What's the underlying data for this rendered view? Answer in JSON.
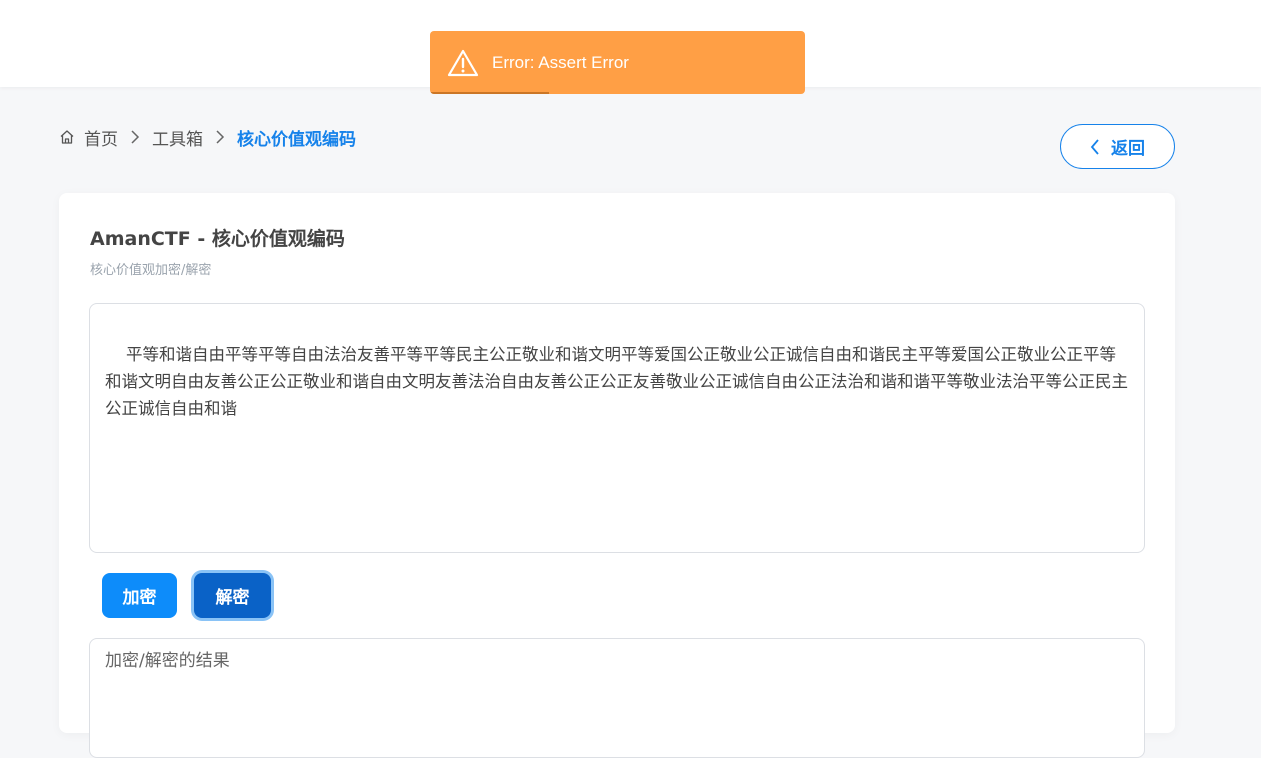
{
  "toast": {
    "message": "Error: Assert Error",
    "icon": "warning-icon",
    "color": "#ff9f45"
  },
  "breadcrumb": {
    "items": [
      "首页",
      "工具箱",
      "核心价值观编码"
    ]
  },
  "back_button": {
    "label": "返回"
  },
  "card": {
    "title": "AmanCTF - 核心价值观编码",
    "subtitle": "核心价值观加密/解密"
  },
  "input": {
    "value": "平等和谐自由平等平等自由法治友善平等平等民主公正敬业和谐文明平等爱国公正敬业公正诚信自由和谐民主平等爱国公正敬业公正平等和谐文明自由友善公正公正敬业和谐自由文明友善法治自由友善公正公正友善敬业公正诚信自由公正法治和谐和谐平等敬业法治平等公正民主公正诚信自由和谐"
  },
  "buttons": {
    "encrypt": "加密",
    "decrypt": "解密"
  },
  "output": {
    "placeholder": "加密/解密的结果"
  },
  "colors": {
    "accent": "#1682ea",
    "button_primary": "#0d8cfa",
    "button_active": "#0a62c7"
  }
}
